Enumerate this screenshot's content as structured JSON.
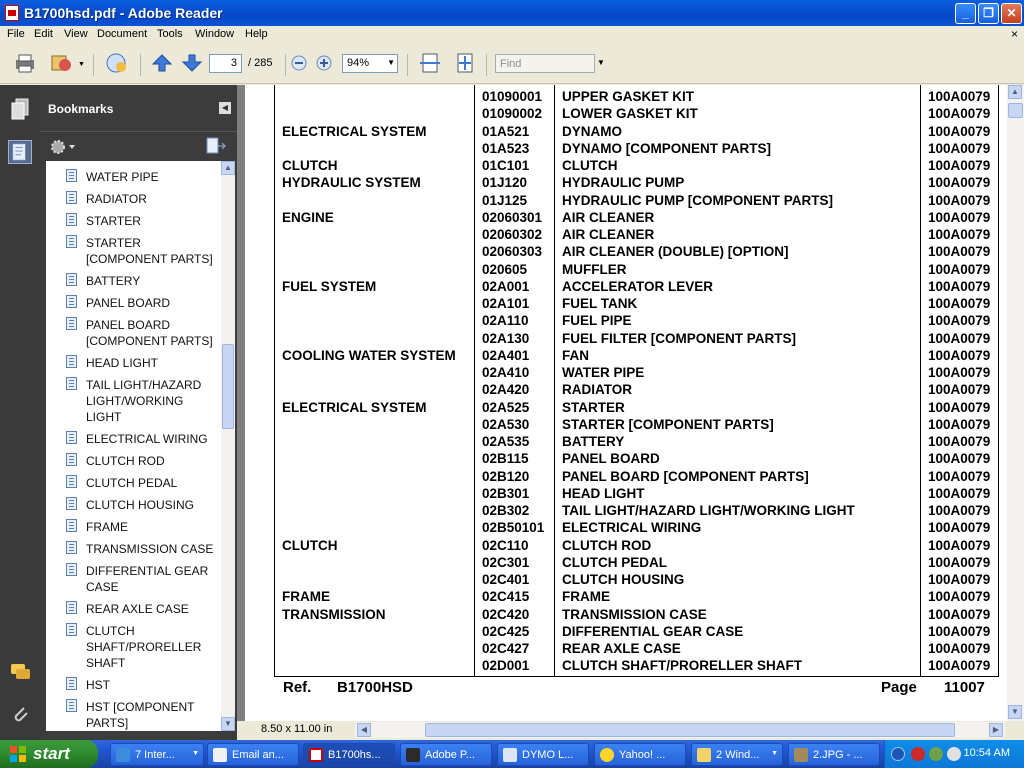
{
  "window": {
    "title": "B1700hsd.pdf - Adobe Reader",
    "minimize": "_",
    "maximize": "❐",
    "close": "✕"
  },
  "menu": [
    "File",
    "Edit",
    "View",
    "Document",
    "Tools",
    "Window",
    "Help"
  ],
  "menu_close": "×",
  "toolbar": {
    "page_current": "3",
    "page_total": "/ 285",
    "zoom": "94%",
    "find_placeholder": "Find"
  },
  "bookmarks": {
    "title": "Bookmarks",
    "items": [
      "WATER PIPE",
      "RADIATOR",
      "STARTER",
      "STARTER [COMPONENT PARTS]",
      "BATTERY",
      "PANEL BOARD",
      "PANEL BOARD [COMPONENT PARTS]",
      "HEAD LIGHT",
      "TAIL LIGHT/HAZARD LIGHT/WORKING LIGHT",
      "ELECTRICAL WIRING",
      "CLUTCH ROD",
      "CLUTCH PEDAL",
      "CLUTCH HOUSING",
      "FRAME",
      "TRANSMISSION CASE",
      "DIFFERENTIAL GEAR CASE",
      "REAR AXLE CASE",
      "CLUTCH SHAFT/PRORELLER SHAFT",
      "HST",
      "HST [COMPONENT PARTS]"
    ]
  },
  "document": {
    "rows": [
      [
        "",
        "01090001",
        "UPPER GASKET KIT",
        "100A0079"
      ],
      [
        "",
        "01090002",
        "LOWER GASKET KIT",
        "100A0079"
      ],
      [
        "ELECTRICAL SYSTEM",
        "01A521",
        "DYNAMO",
        "100A0079"
      ],
      [
        "",
        "01A523",
        "DYNAMO [COMPONENT PARTS]",
        "100A0079"
      ],
      [
        "CLUTCH",
        "01C101",
        "CLUTCH",
        "100A0079"
      ],
      [
        "HYDRAULIC SYSTEM",
        "01J120",
        "HYDRAULIC PUMP",
        "100A0079"
      ],
      [
        "",
        "01J125",
        "HYDRAULIC PUMP [COMPONENT PARTS]",
        "100A0079"
      ],
      [
        "ENGINE",
        "02060301",
        "AIR CLEANER",
        "100A0079"
      ],
      [
        "",
        "02060302",
        "AIR CLEANER",
        "100A0079"
      ],
      [
        "",
        "02060303",
        "AIR CLEANER (DOUBLE)   [OPTION]",
        "100A0079"
      ],
      [
        "",
        "020605",
        "MUFFLER",
        "100A0079"
      ],
      [
        "FUEL SYSTEM",
        "02A001",
        "ACCELERATOR LEVER",
        "100A0079"
      ],
      [
        "",
        "02A101",
        "FUEL TANK",
        "100A0079"
      ],
      [
        "",
        "02A110",
        "FUEL PIPE",
        "100A0079"
      ],
      [
        "",
        "02A130",
        "FUEL FILTER [COMPONENT PARTS]",
        "100A0079"
      ],
      [
        "COOLING WATER SYSTEM",
        "02A401",
        "FAN",
        "100A0079"
      ],
      [
        "",
        "02A410",
        "WATER PIPE",
        "100A0079"
      ],
      [
        "",
        "02A420",
        "RADIATOR",
        "100A0079"
      ],
      [
        "ELECTRICAL SYSTEM",
        "02A525",
        "STARTER",
        "100A0079"
      ],
      [
        "",
        "02A530",
        "STARTER [COMPONENT PARTS]",
        "100A0079"
      ],
      [
        "",
        "02A535",
        "BATTERY",
        "100A0079"
      ],
      [
        "",
        "02B115",
        "PANEL BOARD",
        "100A0079"
      ],
      [
        "",
        "02B120",
        "PANEL BOARD [COMPONENT PARTS]",
        "100A0079"
      ],
      [
        "",
        "02B301",
        "HEAD LIGHT",
        "100A0079"
      ],
      [
        "",
        "02B302",
        "TAIL LIGHT/HAZARD LIGHT/WORKING LIGHT",
        "100A0079"
      ],
      [
        "",
        "02B50101",
        "ELECTRICAL WIRING",
        "100A0079"
      ],
      [
        "CLUTCH",
        "02C110",
        "CLUTCH ROD",
        "100A0079"
      ],
      [
        "",
        "02C301",
        "CLUTCH PEDAL",
        "100A0079"
      ],
      [
        "",
        "02C401",
        "CLUTCH HOUSING",
        "100A0079"
      ],
      [
        "FRAME",
        "02C415",
        "FRAME",
        "100A0079"
      ],
      [
        "TRANSMISSION",
        "02C420",
        "TRANSMISSION CASE",
        "100A0079"
      ],
      [
        "",
        "02C425",
        "DIFFERENTIAL GEAR CASE",
        "100A0079"
      ],
      [
        "",
        "02C427",
        "REAR AXLE CASE",
        "100A0079"
      ],
      [
        "",
        "02D001",
        "CLUTCH SHAFT/PRORELLER SHAFT",
        "100A0079"
      ]
    ],
    "footer_ref_label": "Ref.",
    "footer_ref_value": "B1700HSD",
    "footer_page_label": "Page",
    "footer_page_value": "11007"
  },
  "status": {
    "page_size": "8.50 x 11.00 in"
  },
  "taskbar": {
    "start_label": "start",
    "tasks": [
      "7 Inter...",
      "Email an...",
      "B1700hs...",
      "Adobe P...",
      "DYMO L...",
      "Yahoo! ...",
      "2 Wind...",
      "2.JPG - ..."
    ],
    "clock": "10:54 AM"
  },
  "colors": {
    "titlebar": "#0548c6",
    "panel_dark": "#3c3c3c",
    "doc_bg": "#808080",
    "taskbar": "#245edb",
    "start_green": "#2f8a2f"
  }
}
